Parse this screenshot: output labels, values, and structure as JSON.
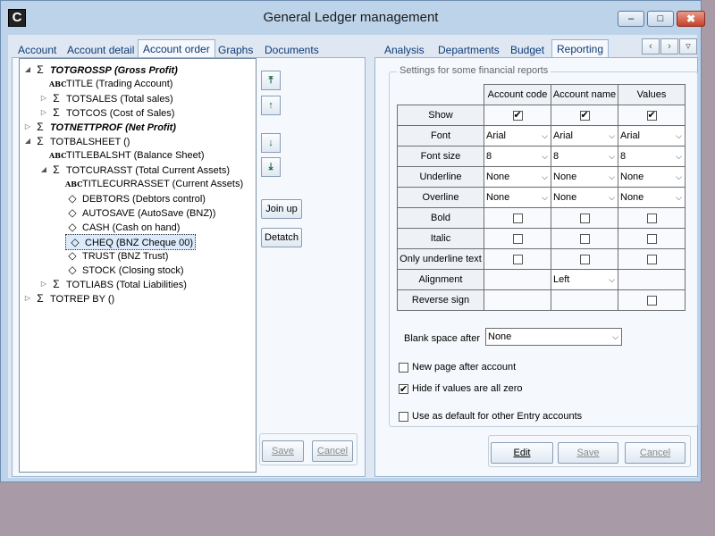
{
  "window": {
    "title": "General Ledger management",
    "icon_letter": "C",
    "min": "–",
    "max": "□",
    "close": "✖"
  },
  "left_tabs": [
    "Account",
    "Account detail",
    "Account order",
    "Graphs",
    "Documents"
  ],
  "right_tabs": [
    "Analysis",
    "Departments",
    "Budget",
    "Reporting"
  ],
  "nav": {
    "prev": "‹",
    "next": "›",
    "down": "▿"
  },
  "tree": [
    {
      "code": "TOTGROSSP",
      "desc": "(Gross Profit)",
      "bold": true,
      "icon": "sigma",
      "level": 0,
      "exp": "open"
    },
    {
      "code": "TITLE",
      "desc": "(Trading Account)",
      "bold": false,
      "icon": "abc",
      "level": 1,
      "exp": ""
    },
    {
      "code": "TOTSALES",
      "desc": "(Total sales)",
      "bold": false,
      "icon": "sigma",
      "level": 1,
      "exp": "closed"
    },
    {
      "code": "TOTCOS",
      "desc": "(Cost of Sales)",
      "bold": false,
      "icon": "sigma",
      "level": 1,
      "exp": "closed"
    },
    {
      "code": "TOTNETTPROF",
      "desc": "(Net Profit)",
      "bold": true,
      "icon": "sigma",
      "level": 0,
      "exp": "closed"
    },
    {
      "code": "TOTBALSHEET",
      "desc": "()",
      "bold": false,
      "icon": "sigma",
      "level": 0,
      "exp": "open"
    },
    {
      "code": "TITLEBALSHT",
      "desc": "(Balance Sheet)",
      "bold": false,
      "icon": "abc",
      "level": 1,
      "exp": ""
    },
    {
      "code": "TOTCURASST",
      "desc": "(Total Current Assets)",
      "bold": false,
      "icon": "sigma",
      "level": 1,
      "exp": "open"
    },
    {
      "code": "TITLECURRASSET",
      "desc": "(Current Assets)",
      "bold": false,
      "icon": "abc",
      "level": 2,
      "exp": ""
    },
    {
      "code": "DEBTORS",
      "desc": "(Debtors control)",
      "bold": false,
      "icon": "ledger",
      "level": 2,
      "exp": ""
    },
    {
      "code": "AUTOSAVE",
      "desc": "(AutoSave (BNZ))",
      "bold": false,
      "icon": "ledger",
      "level": 2,
      "exp": ""
    },
    {
      "code": "CASH",
      "desc": "(Cash on hand)",
      "bold": false,
      "icon": "ledger",
      "level": 2,
      "exp": ""
    },
    {
      "code": "CHEQ",
      "desc": "(BNZ Cheque 00)",
      "bold": false,
      "icon": "ledger",
      "level": 2,
      "exp": "",
      "selected": true
    },
    {
      "code": "TRUST",
      "desc": "(BNZ Trust)",
      "bold": false,
      "icon": "ledger",
      "level": 2,
      "exp": ""
    },
    {
      "code": "STOCK",
      "desc": "(Closing stock)",
      "bold": false,
      "icon": "ledger",
      "level": 2,
      "exp": ""
    },
    {
      "code": "TOTLIABS",
      "desc": "(Total Liabilities)",
      "bold": false,
      "icon": "sigma",
      "level": 1,
      "exp": "closed"
    },
    {
      "code": "TOTREP BY",
      "desc": "()",
      "bold": false,
      "icon": "sigma",
      "level": 0,
      "exp": "closed"
    }
  ],
  "icons": {
    "sigma": "Σ",
    "abc": "ABC",
    "ledger": "◇",
    "exp_open": "◢",
    "exp_closed": "▷",
    "up_top": "⤒",
    "up": "↑",
    "down": "↓",
    "down_bottom": "⤓"
  },
  "left_buttons": {
    "join_up": "Join up",
    "detatch": "Detatch",
    "save": "Save",
    "cancel": "Cancel"
  },
  "settings": {
    "group_label": "Settings for some financial reports",
    "columns": [
      "Account code",
      "Account name",
      "Values"
    ],
    "rows": {
      "show": "Show",
      "font": "Font",
      "font_size": "Font size",
      "underline": "Underline",
      "overline": "Overline",
      "bold": "Bold",
      "italic": "Italic",
      "only_underline": "Only underline text",
      "alignment": "Alignment",
      "reverse_sign": "Reverse sign"
    },
    "font_value": "Arial",
    "font_size_value": "8",
    "line_value": "None",
    "alignment_value": "Left",
    "show_checked": [
      true,
      true,
      true
    ],
    "blank_space_label": "Blank space after",
    "blank_space_value": "None",
    "new_page_label": "New page after account",
    "new_page_checked": false,
    "hide_zero_label": "Hide if values are all zero",
    "hide_zero_checked": true,
    "default_label": "Use as default for other Entry accounts",
    "default_checked": false
  },
  "right_buttons": {
    "edit": "Edit",
    "save": "Save",
    "cancel": "Cancel"
  },
  "colors": {
    "window_frame": "#bcd3ea",
    "tab_text": "#0f3a78",
    "desktop": "#a89aa6"
  }
}
